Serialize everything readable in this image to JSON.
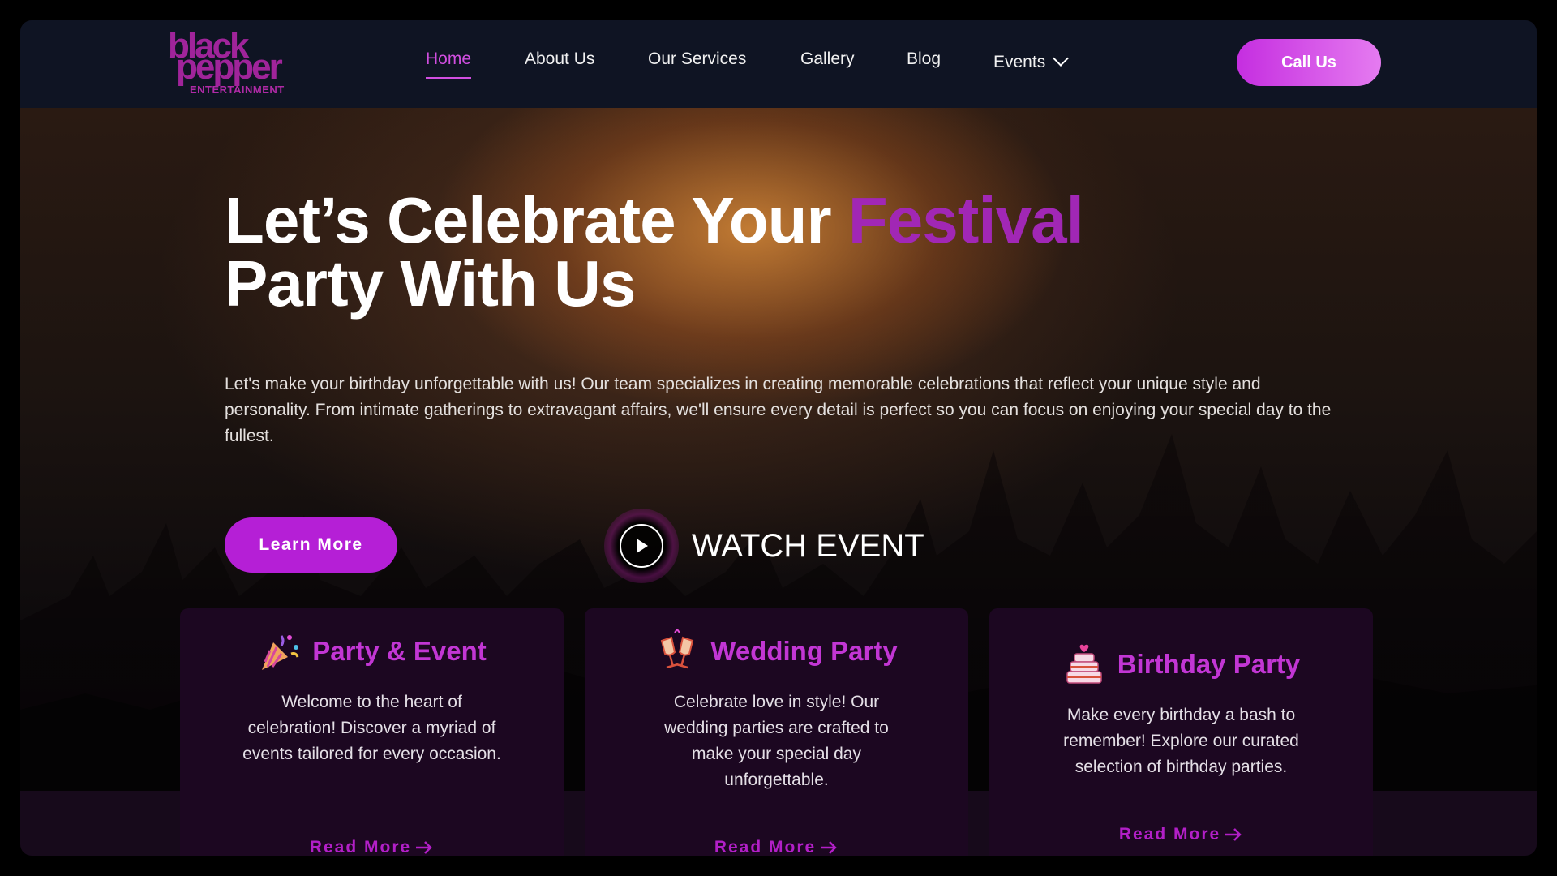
{
  "header": {
    "logo": {
      "line1": "black",
      "line2": "pepper",
      "tagline": "ENTERTAINMENT"
    },
    "nav": [
      {
        "label": "Home",
        "active": true
      },
      {
        "label": "About Us"
      },
      {
        "label": "Our Services"
      },
      {
        "label": "Gallery"
      },
      {
        "label": "Blog"
      },
      {
        "label": "Events",
        "icon": "chevron-down-icon"
      }
    ],
    "cta_label": "Call Us"
  },
  "hero": {
    "title_part1": "Let’s Celebrate Your ",
    "title_accent": "Festival",
    "title_part2": "Party With Us",
    "description": "Let's make your birthday unforgettable with us! Our team specializes in creating memorable celebrations that reflect your unique style and personality. From intimate gatherings to extravagant affairs, we'll ensure every detail is perfect so you can focus on enjoying your special day to the fullest.",
    "primary_button": "Learn More",
    "watch_label": "WATCH EVENT",
    "watch_icon": "play-icon"
  },
  "cards": [
    {
      "title": "Party & Event",
      "icon": "party-popper-icon",
      "text": "Welcome to the heart of celebration! Discover a myriad of events tailored for every occasion.",
      "link": "Read More"
    },
    {
      "title": "Wedding Party",
      "icon": "champagne-glasses-icon",
      "text": "Celebrate love in style! Our wedding parties are crafted to make your special day unforgettable.",
      "link": "Read More"
    },
    {
      "title": "Birthday Party",
      "icon": "birthday-cake-icon",
      "text": "Make every birthday a bash to remember! Explore our curated selection of birthday parties.",
      "link": "Read More"
    }
  ],
  "colors": {
    "accent": "#c236d4",
    "header_bg": "#0f1423",
    "card_bg": "#1c0721"
  }
}
